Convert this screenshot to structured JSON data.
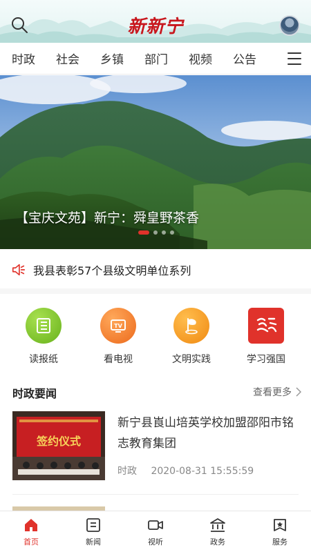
{
  "header": {
    "logo_text": "新新宁",
    "search_icon": "search-icon",
    "avatar": "user-avatar"
  },
  "nav": {
    "tabs": [
      {
        "label": "时政"
      },
      {
        "label": "社会"
      },
      {
        "label": "乡镇"
      },
      {
        "label": "部门"
      },
      {
        "label": "视频"
      },
      {
        "label": "公告"
      }
    ],
    "menu_icon": "hamburger-menu-icon"
  },
  "banner": {
    "caption": "【宝庆文苑】新宁：舜皇野茶香",
    "slides_total": 4,
    "active_slide": 1
  },
  "notice": {
    "icon": "speaker-icon",
    "text": "我县表彰57个县级文明单位系列"
  },
  "quick_links": [
    {
      "label": "读报纸",
      "icon": "newspaper-icon",
      "color": "#7cc42a"
    },
    {
      "label": "看电视",
      "icon": "tv-icon",
      "color": "#f07b22"
    },
    {
      "label": "文明实践",
      "icon": "flag-icon",
      "color": "#f59a1b"
    },
    {
      "label": "学习强国",
      "icon": "xuexi-icon",
      "color": "#e0322b"
    }
  ],
  "section": {
    "title": "时政要闻",
    "more_label": "查看更多"
  },
  "news": [
    {
      "title": "新宁县崀山培英学校加盟邵阳市铭志教育集团",
      "category": "时政",
      "time": "2020-08-31 15:55:59",
      "thumb_banner": "签约仪式"
    }
  ],
  "bottom_nav": [
    {
      "label": "首页",
      "icon": "home-icon",
      "active": true
    },
    {
      "label": "新闻",
      "icon": "news-icon",
      "active": false
    },
    {
      "label": "视听",
      "icon": "video-icon",
      "active": false
    },
    {
      "label": "政务",
      "icon": "government-icon",
      "active": false
    },
    {
      "label": "服务",
      "icon": "service-icon",
      "active": false
    }
  ],
  "colors": {
    "accent": "#e0322b",
    "logo": "#c8161d"
  }
}
